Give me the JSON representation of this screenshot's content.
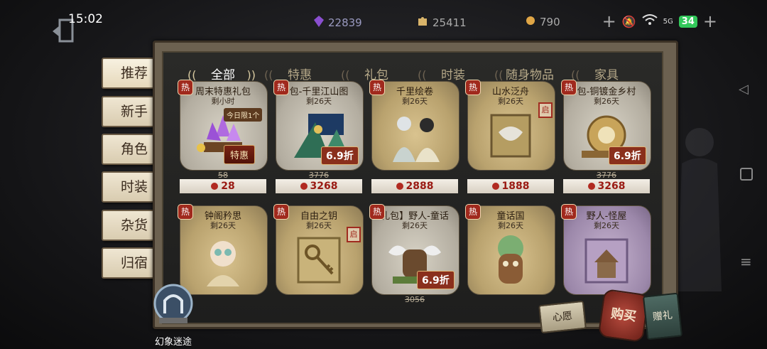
{
  "status_bar": {
    "time": "15:02",
    "gems": "22839",
    "puzzles": "25411",
    "coins": "790",
    "battery": "34",
    "signal": "5G"
  },
  "side_tabs": [
    "推荐",
    "新手",
    "角色",
    "时装",
    "杂货",
    "归宿"
  ],
  "category_tabs": [
    "全部",
    "特惠",
    "礼包",
    "时装",
    "随身物品",
    "家具"
  ],
  "items": [
    {
      "title": "周末特惠礼包",
      "sub": "剩小时",
      "limit": "今日限1个",
      "tag": "特惠",
      "old": "58",
      "price": "28",
      "style": "gray",
      "art": "crystal"
    },
    {
      "title": "包-千里江山图",
      "sub": "剩26天",
      "tag": "6.9折",
      "old": "3776",
      "price": "3268",
      "style": "gray",
      "art": "scroll"
    },
    {
      "title": "千里绘卷",
      "sub": "剩26天",
      "old": "",
      "price": "2888",
      "style": "gold",
      "art": "figures"
    },
    {
      "title": "山水泛舟",
      "sub": "剩26天",
      "seal": "启",
      "old": "",
      "price": "1888",
      "style": "gold",
      "art": "mask"
    },
    {
      "title": "包-铜镀金乡村",
      "sub": "剩26天",
      "tag": "6.9折",
      "old": "3776",
      "price": "3268",
      "style": "gray",
      "art": "clock"
    },
    {
      "title": "钟阁矜思",
      "sub": "剩26天",
      "old": "",
      "price": "",
      "style": "gold",
      "art": "doll"
    },
    {
      "title": "自由之钥",
      "sub": "剩26天",
      "seal": "启",
      "old": "",
      "price": "",
      "style": "gold",
      "art": "key"
    },
    {
      "title": "礼包】野人-童话",
      "sub": "剩26天",
      "tag": "6.9折",
      "old": "3056",
      "price": "",
      "style": "gray",
      "art": "house"
    },
    {
      "title": "童话国",
      "sub": "剩26天",
      "old": "",
      "price": "",
      "style": "gold",
      "art": "tree"
    },
    {
      "title": "野人-怪屋",
      "sub": "剩26天",
      "old": "",
      "price": "",
      "style": "purple",
      "art": "hut"
    }
  ],
  "bottom": {
    "illusion_label": "幻象迷途",
    "wish_label": "心愿",
    "buy_label": "购买",
    "gift_label": "赠礼"
  },
  "icons": {
    "hot": "热"
  }
}
